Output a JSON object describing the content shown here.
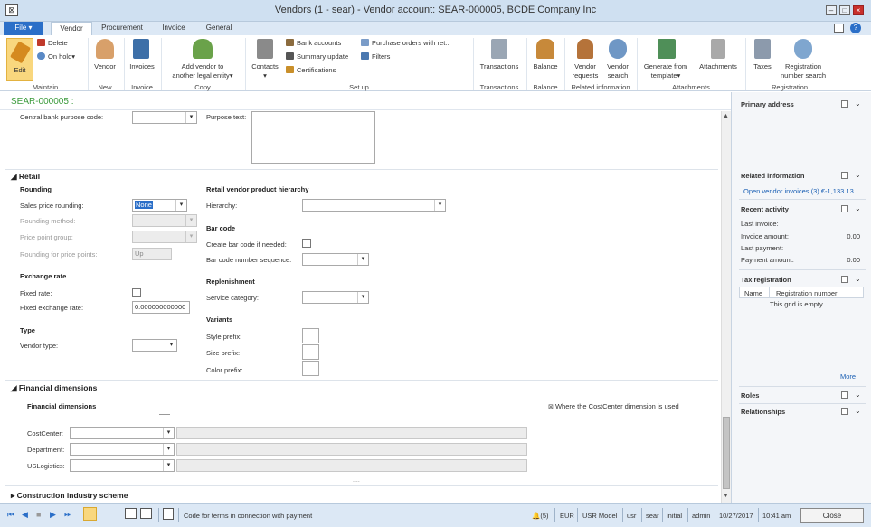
{
  "window": {
    "title": "Vendors (1 - sear) - Vendor account: SEAR-000005, BCDE Company Inc"
  },
  "tabs": [
    "File",
    "Vendor",
    "Procurement",
    "Invoice",
    "General"
  ],
  "ribbon": {
    "maintain": {
      "edit": "Edit",
      "delete": "Delete",
      "on_hold": "On hold",
      "group": "Maintain"
    },
    "new": {
      "vendor": "Vendor",
      "group": "New"
    },
    "invoice": {
      "invoices": "Invoices",
      "group": "Invoice"
    },
    "copy": {
      "add_vendor_l1": "Add vendor to",
      "add_vendor_l2": "another legal entity",
      "group": "Copy"
    },
    "setup": {
      "contacts": "Contacts",
      "bank_accounts": "Bank accounts",
      "summary_update": "Summary update",
      "certifications": "Certifications",
      "purchase_orders": "Purchase orders with ret...",
      "filters": "Filters",
      "group": "Set up"
    },
    "transactions": {
      "label": "Transactions",
      "group": "Transactions"
    },
    "balance": {
      "label": "Balance",
      "group": "Balance"
    },
    "related": {
      "vendor_requests_l1": "Vendor",
      "vendor_requests_l2": "requests",
      "vendor_search_l1": "Vendor",
      "vendor_search_l2": "search",
      "group": "Related information"
    },
    "attachments": {
      "generate_l1": "Generate from",
      "generate_l2": "template",
      "attachments": "Attachments",
      "group": "Attachments"
    },
    "registration": {
      "taxes": "Taxes",
      "reg_search_l1": "Registration",
      "reg_search_l2": "number search",
      "group": "Registration"
    }
  },
  "record": {
    "id": "SEAR-000005 :"
  },
  "top_section": {
    "central_bank": "Central bank purpose code:",
    "purpose_text": "Purpose text:"
  },
  "retail": {
    "title": "Retail",
    "rounding": {
      "title": "Rounding",
      "sales_price_rounding": "Sales price rounding:",
      "sales_price_rounding_value": "None",
      "rounding_method": "Rounding method:",
      "price_point_group": "Price point group:",
      "rounding_for_price_points": "Rounding for price points:",
      "rounding_for_price_points_value": "Up"
    },
    "exchange": {
      "title": "Exchange rate",
      "fixed_rate": "Fixed rate:",
      "fixed_exchange_rate": "Fixed exchange rate:",
      "fixed_exchange_rate_value": "0.000000000000"
    },
    "type": {
      "title": "Type",
      "vendor_type": "Vendor type:"
    },
    "hierarchy": {
      "title": "Retail vendor product hierarchy",
      "hierarchy": "Hierarchy:"
    },
    "barcode": {
      "title": "Bar code",
      "create_if_needed": "Create bar code if needed:",
      "sequence": "Bar code number sequence:"
    },
    "replenishment": {
      "title": "Replenishment",
      "service_category": "Service category:"
    },
    "variants": {
      "title": "Variants",
      "style_prefix": "Style prefix:",
      "size_prefix": "Size prefix:",
      "color_prefix": "Color prefix:"
    }
  },
  "financial": {
    "title": "Financial dimensions",
    "subtitle": "Financial dimensions",
    "costcenter_note": "Where the CostCenter dimension is used",
    "fields": [
      "CostCenter:",
      "Department:",
      "USLogistics:"
    ]
  },
  "construction": {
    "title": "Construction industry scheme"
  },
  "rightpane": {
    "primary_address": "Primary address",
    "related_information": "Related information",
    "open_vendor_invoices": "Open vendor invoices (3) €-1,133.13",
    "recent_activity": "Recent activity",
    "activity": [
      {
        "label": "Last invoice:",
        "value": ""
      },
      {
        "label": "Invoice amount:",
        "value": "0.00"
      },
      {
        "label": "Last payment:",
        "value": ""
      },
      {
        "label": "Payment amount:",
        "value": "0.00"
      }
    ],
    "tax_registration": "Tax registration",
    "tax_cols": [
      "Name",
      "Registration number"
    ],
    "tax_empty": "This grid is empty.",
    "more": "More",
    "roles": "Roles",
    "relationships": "Relationships"
  },
  "statusbar": {
    "help_text": "Code for terms in connection with payment",
    "alerts": "(5)",
    "currency": "EUR",
    "model": "USR Model",
    "user": "usr",
    "company": "sear",
    "layer": "initial",
    "role": "admin",
    "date": "10/27/2017",
    "time": "10:41 am",
    "close": "Close"
  },
  "colors": {
    "accent": "#2b6fc8",
    "record_id": "#3a9a3a",
    "link": "#1a5fb4",
    "edit_bg": "#f9d77e"
  }
}
